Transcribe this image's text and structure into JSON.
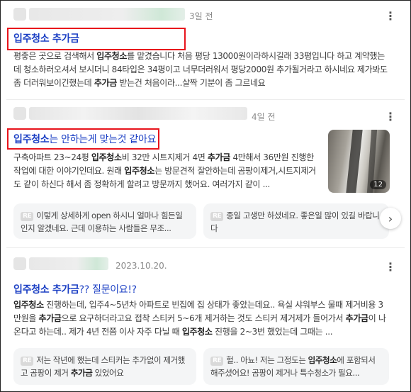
{
  "results": [
    {
      "date": "3일 전",
      "title_keyword": "입주청소 추가금",
      "snippet_1": "평좋은 곳으로 검색해서 ",
      "snippet_kw": "입주청소",
      "snippet_2": "를 맡겼습니다 처음 평당 13000원이라하시길래 33평입니다 하고 계약했는데 청소하러오셔서 보시더니 84타입은 34평이고 너무더러워서 평당2000원 추가될거라고 하시네요 제가봐도 좀 더러워보이긴했는데 ",
      "snippet_kw2": "추가금",
      "snippet_3": " 받는건 처음이라...살짝 기분이 좀 그르네요"
    },
    {
      "date": "4일 전",
      "title_keyword": "입주청소",
      "title_rest": "는 안하는게 맞는것 같아요",
      "s1": "구축아파트 23~24평 ",
      "k1": "입주청소",
      "s2": "비 32만 시트지제거 4면 ",
      "k2": "추가금",
      "s3": " 4만해서 36만원 진행한 작업에 대한 이야기인데요. 원래 ",
      "k3": "입주청소",
      "s4": "는 방문견적 잘안하는데 곰팡이제거,시트지제거도 같이 하신다 해서 좀 정확하게 할려고 방문까지 했어요. 여러가지 같이 ...",
      "thumb_count": "12",
      "comment_1": "이렇게 상세하게 open 하시니 얼마나 힘든일인지 알겠네요. 근데 이용하는 사람들은 무조...",
      "comment_2": "종일 고생만 하셨네요. 좋은일 많이 있길 바랍니다"
    },
    {
      "date": "2023.10.20.",
      "title_keyword": "입주청소 추가금",
      "title_rest": "?? 질문이요!?",
      "k1": "입주청소",
      "s1": " 진행하는데, 입주4~5년차 아파트로 빈집에 집 상태가 좋았는데요.. 욕실 샤워부스 물때 제거비용 3만원을 ",
      "k2": "추가금",
      "s2": "으로 요구하더라고요 접착 스티커 5~6개 제거하는 것도 스티커 제거제가 들어가서 ",
      "k3": "추가금",
      "s3": "이 나온다고 하는데.. 제가 4년 전쯤 이사 자주 다닐 때 ",
      "k4": "입주청소",
      "s4": " 진행을 2~3번 했었는데 그때는 ...",
      "c1a": "저는 작년에 했는데 스티커는 추가없이 제거했고 곰팡이 제거 ",
      "c1k": "추가금",
      "c1b": " 있었어요",
      "c2a": "헐.. 아뇨! 저는 그정도는 ",
      "c2k": "입주청소",
      "c2b": "에 포함되서 해주셨어요! 곰팡이 제거나 특수청소가 필요..."
    }
  ],
  "labels": {
    "reply_badge": "RE",
    "more": "⋮",
    "next": "›"
  }
}
